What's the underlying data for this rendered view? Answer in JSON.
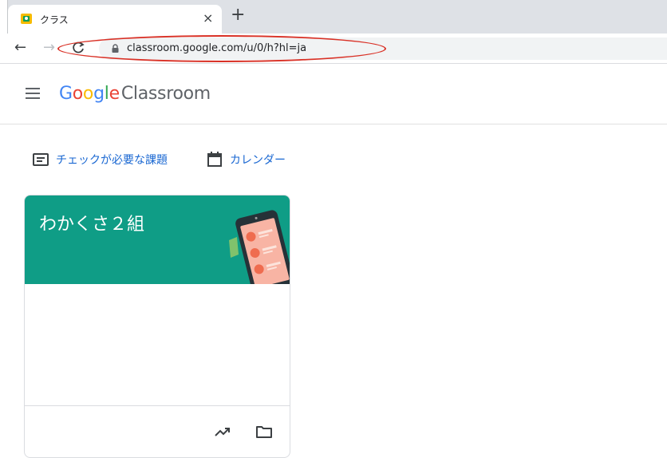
{
  "browser": {
    "tab_title": "クラス",
    "tab_close": "×",
    "new_tab": "+",
    "back": "←",
    "forward": "→",
    "url": "classroom.google.com/u/0/h?hl=ja",
    "annotation_color": "#d93025"
  },
  "app": {
    "brand_google": [
      "G",
      "o",
      "o",
      "g",
      "l",
      "e"
    ],
    "brand_product": "Classroom",
    "quicklinks": [
      {
        "label": "チェックが必要な課題",
        "icon": "todo-list-icon"
      },
      {
        "label": "カレンダー",
        "icon": "calendar-icon"
      }
    ],
    "class_card": {
      "title": "わかくさ２組",
      "banner_color": "#0f9d86",
      "footer_icons": [
        "trending-up-icon",
        "folder-icon"
      ]
    }
  }
}
